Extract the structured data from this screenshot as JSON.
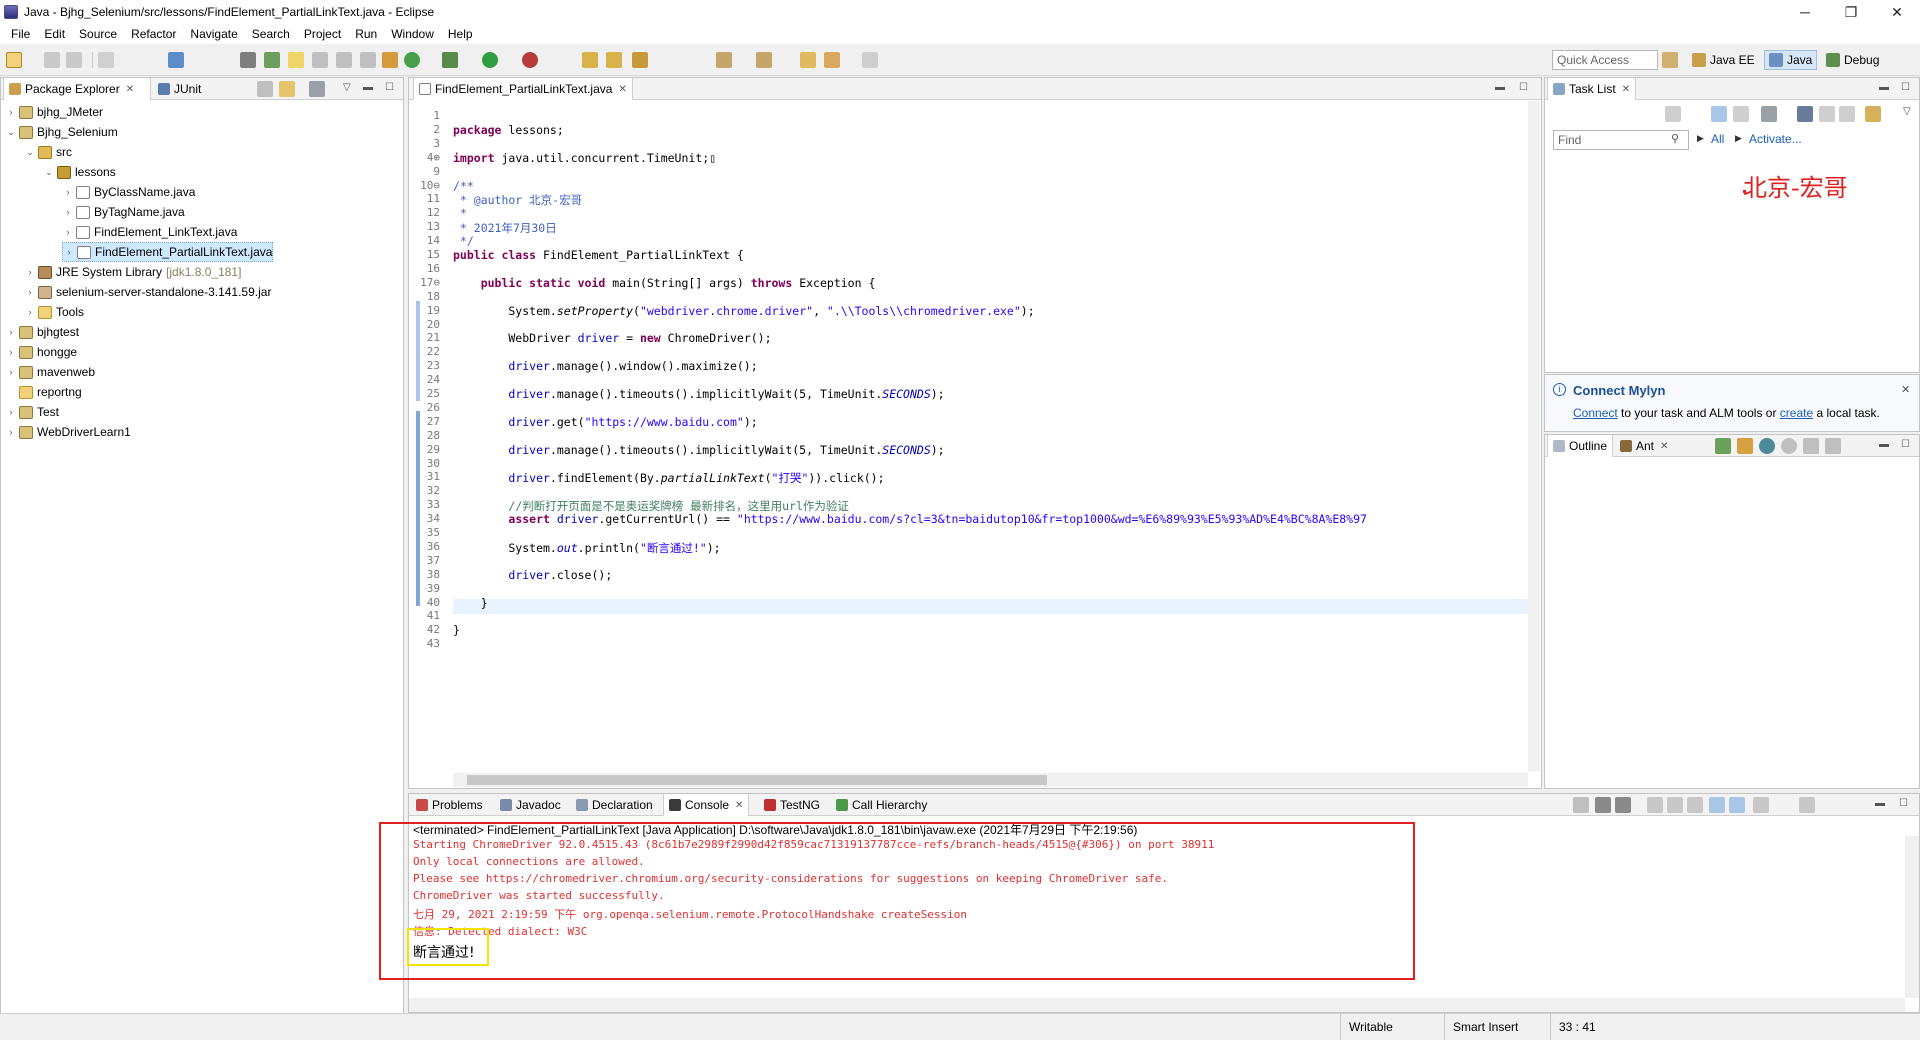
{
  "window": {
    "title": "Java - Bjhg_Selenium/src/lessons/FindElement_PartialLinkText.java - Eclipse",
    "minimize": "─",
    "restore": "❐",
    "close": "✕"
  },
  "menu": [
    "File",
    "Edit",
    "Source",
    "Refactor",
    "Navigate",
    "Search",
    "Project",
    "Run",
    "Window",
    "Help"
  ],
  "toolbar": {
    "quick_access_placeholder": "Quick Access",
    "perspectives": [
      "Java EE",
      "Java",
      "Debug"
    ]
  },
  "package_explorer": {
    "tabs": [
      "Package Explorer",
      "JUnit"
    ],
    "tree": [
      {
        "label": "bjhg_JMeter",
        "icon": "project-icon",
        "depth": 0,
        "expanded": false
      },
      {
        "label": "Bjhg_Selenium",
        "icon": "project-icon",
        "depth": 0,
        "expanded": true
      },
      {
        "label": "src",
        "icon": "source-folder-icon",
        "depth": 1,
        "expanded": true
      },
      {
        "label": "lessons",
        "icon": "package-icon",
        "depth": 2,
        "expanded": true
      },
      {
        "label": "ByClassName.java",
        "icon": "java-file-icon",
        "depth": 3,
        "expanded": false
      },
      {
        "label": "ByTagName.java",
        "icon": "java-file-icon",
        "depth": 3,
        "expanded": false
      },
      {
        "label": "FindElement_LinkText.java",
        "icon": "java-file-icon",
        "depth": 3,
        "expanded": false
      },
      {
        "label": "FindElement_PartialLinkText.java",
        "icon": "java-file-icon",
        "depth": 3,
        "expanded": false,
        "selected": true
      },
      {
        "label": "JRE System Library",
        "suffix": "[jdk1.8.0_181]",
        "icon": "library-icon",
        "depth": 1,
        "expanded": false
      },
      {
        "label": "selenium-server-standalone-3.141.59.jar",
        "icon": "jar-icon",
        "depth": 1,
        "expanded": false
      },
      {
        "label": "Tools",
        "icon": "folder-icon",
        "depth": 1,
        "expanded": false
      },
      {
        "label": "bjhgtest",
        "icon": "project-icon",
        "depth": 0,
        "expanded": false
      },
      {
        "label": "hongge",
        "icon": "project-icon",
        "depth": 0,
        "expanded": false
      },
      {
        "label": "mavenweb",
        "icon": "project-icon",
        "depth": 0,
        "expanded": false
      },
      {
        "label": "reportng",
        "icon": "folder-icon",
        "depth": 0,
        "expanded": null
      },
      {
        "label": "Test",
        "icon": "project-icon",
        "depth": 0,
        "expanded": false
      },
      {
        "label": "WebDriverLearn1",
        "icon": "project-icon",
        "depth": 0,
        "expanded": false
      }
    ]
  },
  "editor": {
    "tab": "FindElement_PartialLinkText.java",
    "lines": [
      {
        "n": "1",
        "html": ""
      },
      {
        "n": "2",
        "html": "<span class='kw'>package</span> lessons;"
      },
      {
        "n": "3",
        "html": ""
      },
      {
        "n": "4⊕",
        "html": "<span class='kw'>import</span> java.util.concurrent.TimeUnit;▯"
      },
      {
        "n": "9",
        "html": ""
      },
      {
        "n": "10⊖",
        "html": "<span class='jd'>/**</span>"
      },
      {
        "n": "11",
        "html": "<span class='jd'> * @author 北京-宏哥</span>"
      },
      {
        "n": "12",
        "html": "<span class='jd'> *</span>"
      },
      {
        "n": "13",
        "html": "<span class='jd'> * 2021年7月30日</span>"
      },
      {
        "n": "14",
        "html": "<span class='jd'> */</span>"
      },
      {
        "n": "15",
        "html": "<span class='kw'>public class</span> FindElement_PartialLinkText {"
      },
      {
        "n": "16",
        "html": ""
      },
      {
        "n": "17⊖",
        "html": "    <span class='kw'>public static void</span> main(String[] args) <span class='kw'>throws</span> Exception {"
      },
      {
        "n": "18",
        "html": ""
      },
      {
        "n": "19",
        "html": "        System.<span class='it'>setProperty</span>(<span class='str'>\"webdriver.chrome.driver\"</span>, <span class='str'>\".\\\\Tools\\\\chromedriver.exe\"</span>);"
      },
      {
        "n": "20",
        "html": ""
      },
      {
        "n": "21",
        "html": "        WebDriver <span class='fld'>driver</span> = <span class='kw'>new</span> ChromeDriver();"
      },
      {
        "n": "22",
        "html": ""
      },
      {
        "n": "23",
        "html": "        <span class='fld'>driver</span>.manage().window().maximize();"
      },
      {
        "n": "24",
        "html": ""
      },
      {
        "n": "25",
        "html": "        <span class='fld'>driver</span>.manage().timeouts().implicitlyWait(5, TimeUnit.<span class='stat'>SECONDS</span>);"
      },
      {
        "n": "26",
        "html": ""
      },
      {
        "n": "27",
        "html": "        <span class='fld'>driver</span>.get(<span class='str'>\"https://www.baidu.com\"</span>);"
      },
      {
        "n": "28",
        "html": ""
      },
      {
        "n": "29",
        "html": "        <span class='fld'>driver</span>.manage().timeouts().implicitlyWait(5, TimeUnit.<span class='stat'>SECONDS</span>);"
      },
      {
        "n": "30",
        "html": ""
      },
      {
        "n": "31",
        "html": "        <span class='fld'>driver</span>.findElement(By.<span class='it'>partialLinkText</span>(<span class='str'>\"打哭\"</span>)).click();"
      },
      {
        "n": "32",
        "html": ""
      },
      {
        "n": "33",
        "html": "        <span class='cm'>//判断打开页面是不是奥运奖牌榜 最新排名，这里用url作为验证</span>"
      },
      {
        "n": "34",
        "html": "        <span class='kw'>assert</span> <span class='fld'>driver</span>.getCurrentUrl() == <span class='str'>\"https://www.baidu.com/s?cl=3&amp;tn=baidutop10&amp;fr=top1000&amp;wd=%E6%89%93%E5%93%AD%E4%BC%8A%E8%97</span>"
      },
      {
        "n": "35",
        "html": ""
      },
      {
        "n": "36",
        "html": "        System.<span class='fld it'>out</span>.println(<span class='str'>\"断言通过!\"</span>);"
      },
      {
        "n": "37",
        "html": ""
      },
      {
        "n": "38",
        "html": "        <span class='fld'>driver</span>.close();"
      },
      {
        "n": "39",
        "html": ""
      },
      {
        "n": "40",
        "html": "    }"
      },
      {
        "n": "41",
        "html": ""
      },
      {
        "n": "42",
        "html": "}"
      },
      {
        "n": "43",
        "html": ""
      }
    ]
  },
  "task_list": {
    "tab": "Task List",
    "find_placeholder": "Find",
    "all": "All",
    "activate": "Activate...",
    "watermark": "北京-宏哥"
  },
  "mylyn": {
    "title": "Connect Mylyn",
    "connect": "Connect",
    "middle": " to your task and ALM tools or ",
    "create": "create",
    "end": " a local task."
  },
  "outline": {
    "tabs": [
      "Outline",
      "Ant"
    ]
  },
  "bottom_tabs": [
    "Problems",
    "Javadoc",
    "Declaration",
    "Console",
    "TestNG",
    "Call Hierarchy"
  ],
  "console": {
    "header": "<terminated> FindElement_PartialLinkText [Java Application] D:\\software\\Java\\jdk1.8.0_181\\bin\\javaw.exe (2021年7月29日 下午2:19:56)",
    "lines": [
      "Starting ChromeDriver 92.0.4515.43 (8c61b7e2989f2990d42f859cac71319137787cce-refs/branch-heads/4515@{#306}) on port 38911",
      "Only local connections are allowed.",
      "Please see https://chromedriver.chromium.org/security-considerations for suggestions on keeping ChromeDriver safe.",
      "ChromeDriver was started successfully.",
      "七月 29, 2021 2:19:59 下午 org.openqa.selenium.remote.ProtocolHandshake createSession",
      "信息: Detected dialect: W3C"
    ],
    "output": "断言通过!"
  },
  "status": {
    "writable": "Writable",
    "insert_mode": "Smart Insert",
    "position": "33 : 41"
  },
  "colors": {
    "highlight_red": "#e02020",
    "highlight_yellow": "#f5e400",
    "console_error": "#e03030"
  }
}
